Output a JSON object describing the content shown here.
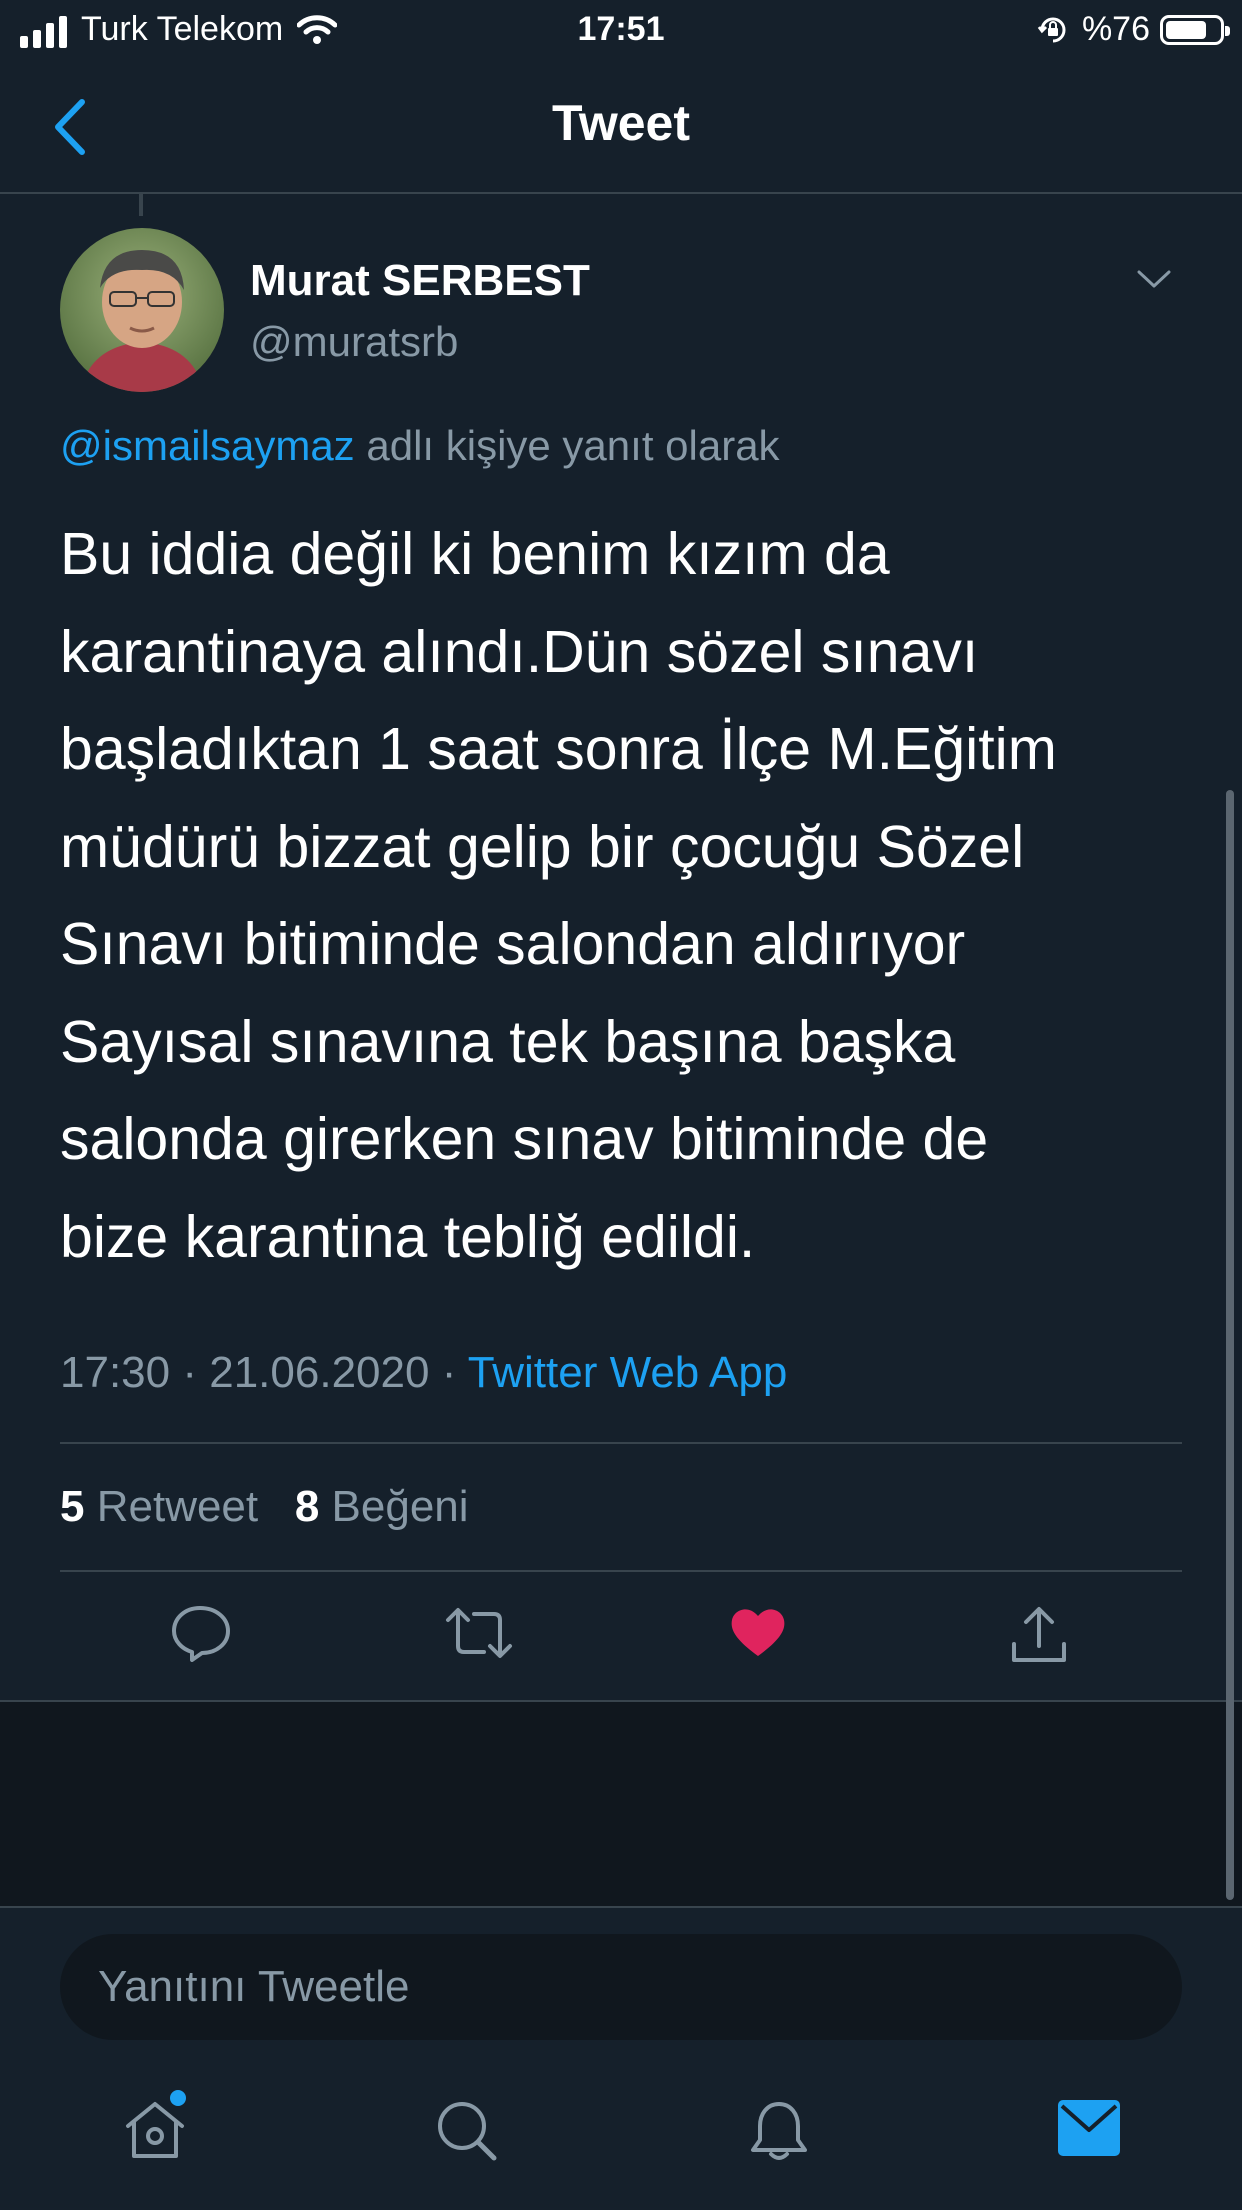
{
  "status_bar": {
    "carrier": "Turk Telekom",
    "time": "17:51",
    "battery": "%76",
    "battery_level": 0.76
  },
  "nav": {
    "title": "Tweet",
    "back_icon": "back-chevron-icon"
  },
  "tweet": {
    "author_name": "Murat SERBEST",
    "author_handle": "@muratsrb",
    "reply_mention": "@ismailsaymaz",
    "reply_suffix": "adlı kişiye yanıt olarak",
    "lines": [
      "Bu iddia değil ki benim kızım da",
      "karantinaya alındı.Dün sözel sınavı",
      "başladıktan 1 saat sonra İlçe M.Eğitim",
      "müdürü bizzat gelip bir çocuğu Sözel",
      "Sınavı bitiminde salondan aldırıyor",
      "Sayısal sınavına tek başına başka",
      "salonda girerken sınav bitiminde de",
      "bize karantina tebliğ edildi."
    ],
    "time": "17:30",
    "date": "21.06.2020",
    "separator": "·",
    "source": "Twitter Web App",
    "retweet_count": "5",
    "retweet_label": "Retweet",
    "like_count": "8",
    "like_label": "Beğeni"
  },
  "actions": [
    "reply-icon",
    "retweet-icon",
    "like-icon",
    "share-icon"
  ],
  "reply_bar": {
    "placeholder": "Yanıtını Tweetle"
  },
  "tab_bar": [
    "home-icon",
    "search-icon",
    "notifications-icon",
    "messages-icon"
  ],
  "colors": {
    "background": "#15202b",
    "accent": "#1da1f2",
    "like": "#e0245e",
    "secondary_text": "#8899a6"
  }
}
